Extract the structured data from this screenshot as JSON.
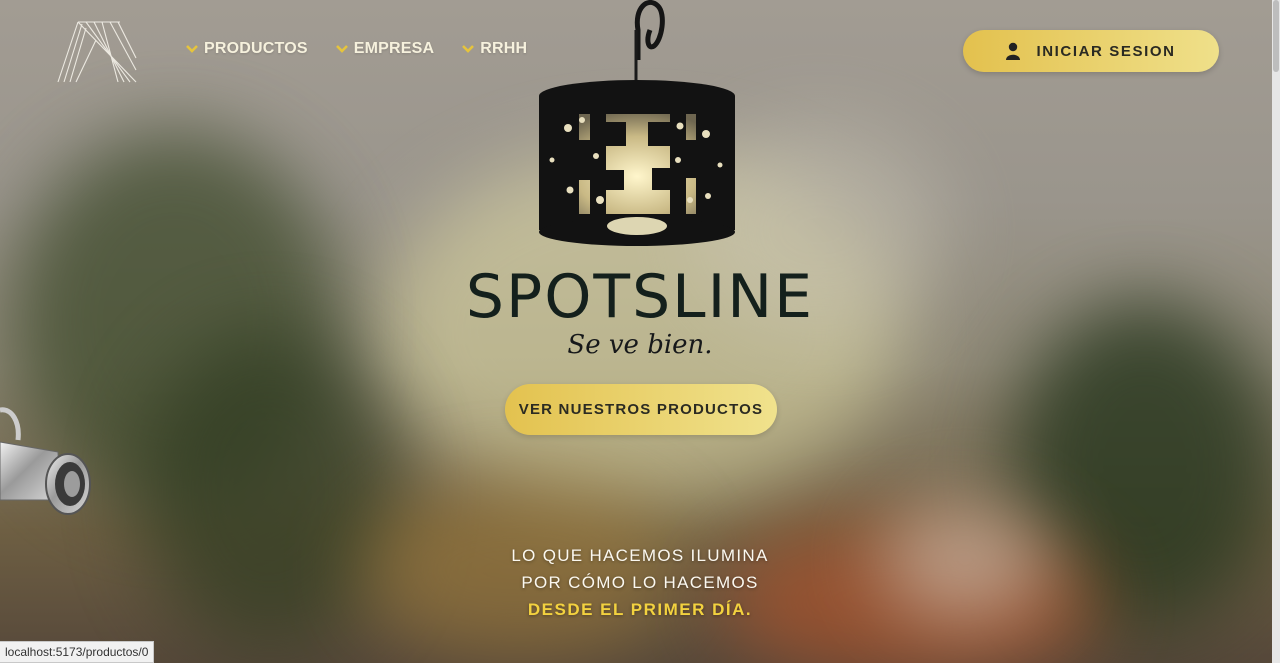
{
  "brand": {
    "name": "SPOTSLINE",
    "tagline": "Se ve bien."
  },
  "nav": {
    "items": [
      {
        "label": "PRODUCTOS",
        "icon": "chevron-down-icon"
      },
      {
        "label": "EMPRESA",
        "icon": "chevron-down-icon"
      },
      {
        "label": "RRHH",
        "icon": "chevron-down-icon"
      }
    ]
  },
  "login": {
    "label": "INICIAR SESION",
    "icon": "user-icon"
  },
  "hero": {
    "cta_label": "VER NUESTROS PRODUCTOS",
    "motto_line1": "LO QUE HACEMOS ILUMINA",
    "motto_line2": "POR CÓMO LO HACEMOS",
    "motto_highlight": "DESDE EL PRIMER DÍA."
  },
  "status_bar": {
    "url": "localhost:5173/productos/0"
  },
  "colors": {
    "accent": "#e8c94f",
    "accent_light": "#f0e28d",
    "highlight_text": "#f3d23f",
    "brand_text": "#14201c"
  }
}
